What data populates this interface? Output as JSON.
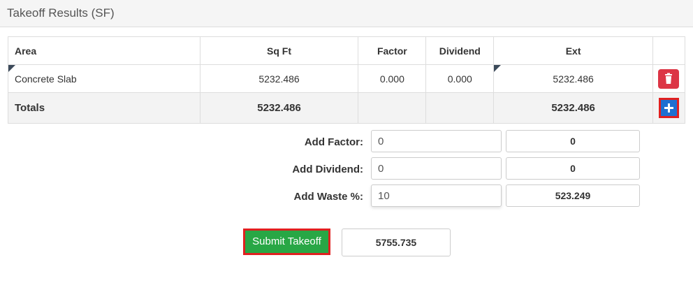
{
  "header": {
    "title": "Takeoff Results (SF)"
  },
  "table": {
    "columns": [
      "Area",
      "Sq Ft",
      "Factor",
      "Dividend",
      "Ext"
    ],
    "rows": [
      {
        "area": "Concrete Slab",
        "sqft": "5232.486",
        "factor": "0.000",
        "dividend": "0.000",
        "ext": "5232.486"
      }
    ],
    "totals": {
      "label": "Totals",
      "sqft": "5232.486",
      "ext": "5232.486"
    }
  },
  "adjustments": {
    "factor": {
      "label": "Add Factor:",
      "value": "0",
      "result": "0"
    },
    "dividend": {
      "label": "Add Dividend:",
      "value": "0",
      "result": "0"
    },
    "waste": {
      "label": "Add Waste %:",
      "value": "10",
      "result": "523.249"
    }
  },
  "submit": {
    "label": "Submit Takeoff",
    "total": "5755.735"
  },
  "icons": {
    "delete": "trash-icon",
    "add": "plus-icon"
  },
  "colors": {
    "delete": "#dc3545",
    "add": "#1f6fd1",
    "submit": "#28a745",
    "highlight": "#e02020"
  }
}
